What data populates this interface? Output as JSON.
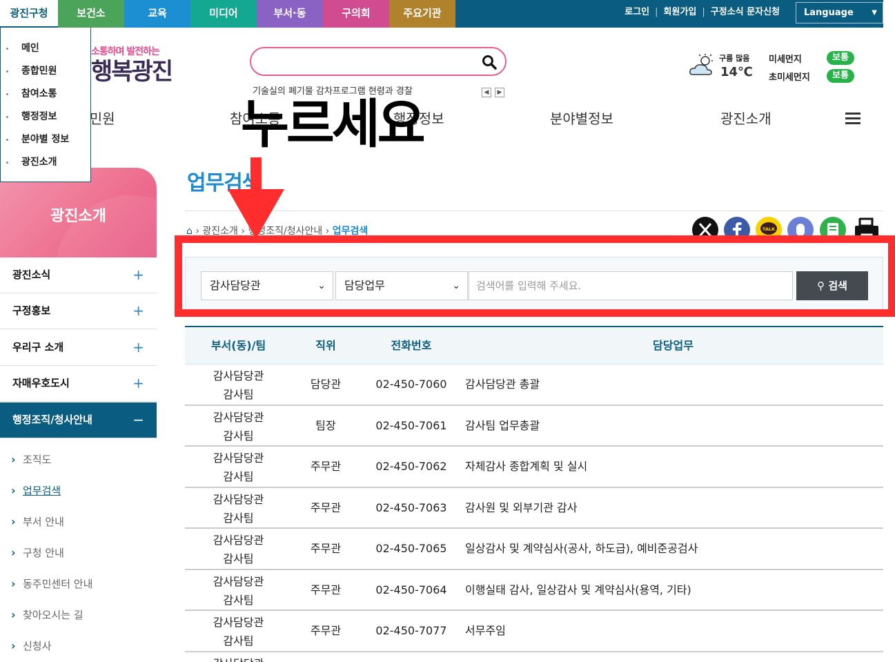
{
  "site_tabs": [
    "광진구청",
    "보건소",
    "교육",
    "미디어",
    "부서·동",
    "구의회",
    "주요기관"
  ],
  "site_tab_colors": [
    "#ffffff",
    "#4ba45a",
    "#1b8fd2",
    "#14a792",
    "#8a62c4",
    "#d14b91",
    "#b0822c"
  ],
  "util_links": [
    "로그인",
    "회원가입",
    "구정소식 문자신청"
  ],
  "language_label": "Language",
  "site_submenu": [
    "메인",
    "종합민원",
    "참여소통",
    "행정정보",
    "분야별 정보",
    "광진소개"
  ],
  "logo": {
    "line1": "소통하며 발전하는",
    "line2": "행복광진"
  },
  "search": {
    "placeholder": "",
    "keywords": "기술실의 폐기물 감차프로그램 현령과 경찰"
  },
  "weather": {
    "desc": "구름 많음",
    "temp": "14℃"
  },
  "dust": [
    {
      "label": "미세먼지",
      "status": "보통"
    },
    {
      "label": "초미세먼지",
      "status": "보통"
    }
  ],
  "main_nav": [
    "종합민원",
    "참여소통",
    "행정정보",
    "분야별정보",
    "광진소개"
  ],
  "overlay": {
    "text": "누르세요"
  },
  "lnb": {
    "title": "광진소개",
    "items": [
      {
        "label": "광진소식",
        "toggle": "+"
      },
      {
        "label": "구정홍보",
        "toggle": "+"
      },
      {
        "label": "우리구 소개",
        "toggle": "+"
      },
      {
        "label": "자매우호도시",
        "toggle": "+"
      },
      {
        "label": "행정조직/청사안내",
        "toggle": "−"
      }
    ],
    "sub_items": [
      "조직도",
      "업무검색",
      "부서 안내",
      "구청 안내",
      "동주민센터 안내",
      "찾아오시는 길",
      "신청사"
    ]
  },
  "page_title": "업무검색",
  "breadcrumb": {
    "items": [
      "광진소개",
      "행정조직/청사안내"
    ],
    "current": "업무검색"
  },
  "share_icons": [
    "x-icon",
    "facebook-icon",
    "kakaotalk-icon",
    "band-icon",
    "blog-icon",
    "print-icon"
  ],
  "search_form": {
    "dept_select": "감사담당관",
    "field_select": "담당업무",
    "keyword_placeholder": "검색어를 입력해 주세요.",
    "button_label": "검색"
  },
  "table": {
    "headers": [
      "부서(동)/팀",
      "직위",
      "전화번호",
      "담당업무"
    ],
    "rows": [
      {
        "dept": "감사담당관",
        "team": "감사팀",
        "position": "담당관",
        "phone": "02-450-7060",
        "task": "감사담당관 총괄"
      },
      {
        "dept": "감사담당관",
        "team": "감사팀",
        "position": "팀장",
        "phone": "02-450-7061",
        "task": "감사팀 업무총괄"
      },
      {
        "dept": "감사담당관",
        "team": "감사팀",
        "position": "주무관",
        "phone": "02-450-7062",
        "task": "자체감사 종합계획 및 실시"
      },
      {
        "dept": "감사담당관",
        "team": "감사팀",
        "position": "주무관",
        "phone": "02-450-7063",
        "task": "감사원 및 외부기관 감사"
      },
      {
        "dept": "감사담당관",
        "team": "감사팀",
        "position": "주무관",
        "phone": "02-450-7065",
        "task": "일상감사 및 계약심사(공사, 하도급), 예비준공검사"
      },
      {
        "dept": "감사담당관",
        "team": "감사팀",
        "position": "주무관",
        "phone": "02-450-7064",
        "task": "이행실태 감사, 일상감사 및 계약심사(용역, 기타)"
      },
      {
        "dept": "감사담당관",
        "team": "감사팀",
        "position": "주무관",
        "phone": "02-450-7077",
        "task": "서무주임"
      },
      {
        "dept": "감사담당관",
        "team": "",
        "position": "",
        "phone": "",
        "task": ""
      }
    ]
  }
}
